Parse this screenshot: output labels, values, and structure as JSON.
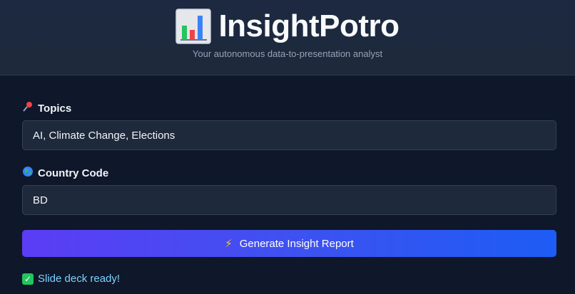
{
  "header": {
    "icon": "bar-chart-icon",
    "title": "InsightPotro",
    "subtitle": "Your autonomous data-to-presentation analyst"
  },
  "form": {
    "topics": {
      "icon": "pushpin-icon",
      "label": "Topics",
      "value": "AI, Climate Change, Elections"
    },
    "country": {
      "icon": "globe-icon",
      "label": "Country Code",
      "value": "BD"
    },
    "submit": {
      "icon": "lightning-icon",
      "label": "Generate Insight Report"
    }
  },
  "status": {
    "icon": "check-icon",
    "text": "Slide deck ready!"
  },
  "colors": {
    "background": "#0f172a",
    "header_bg": "#1e293b",
    "input_bg": "#1e293b",
    "button_start": "#5b3df5",
    "button_end": "#1d5cf5",
    "status_text": "#7dd3fc",
    "success": "#22c55e"
  }
}
